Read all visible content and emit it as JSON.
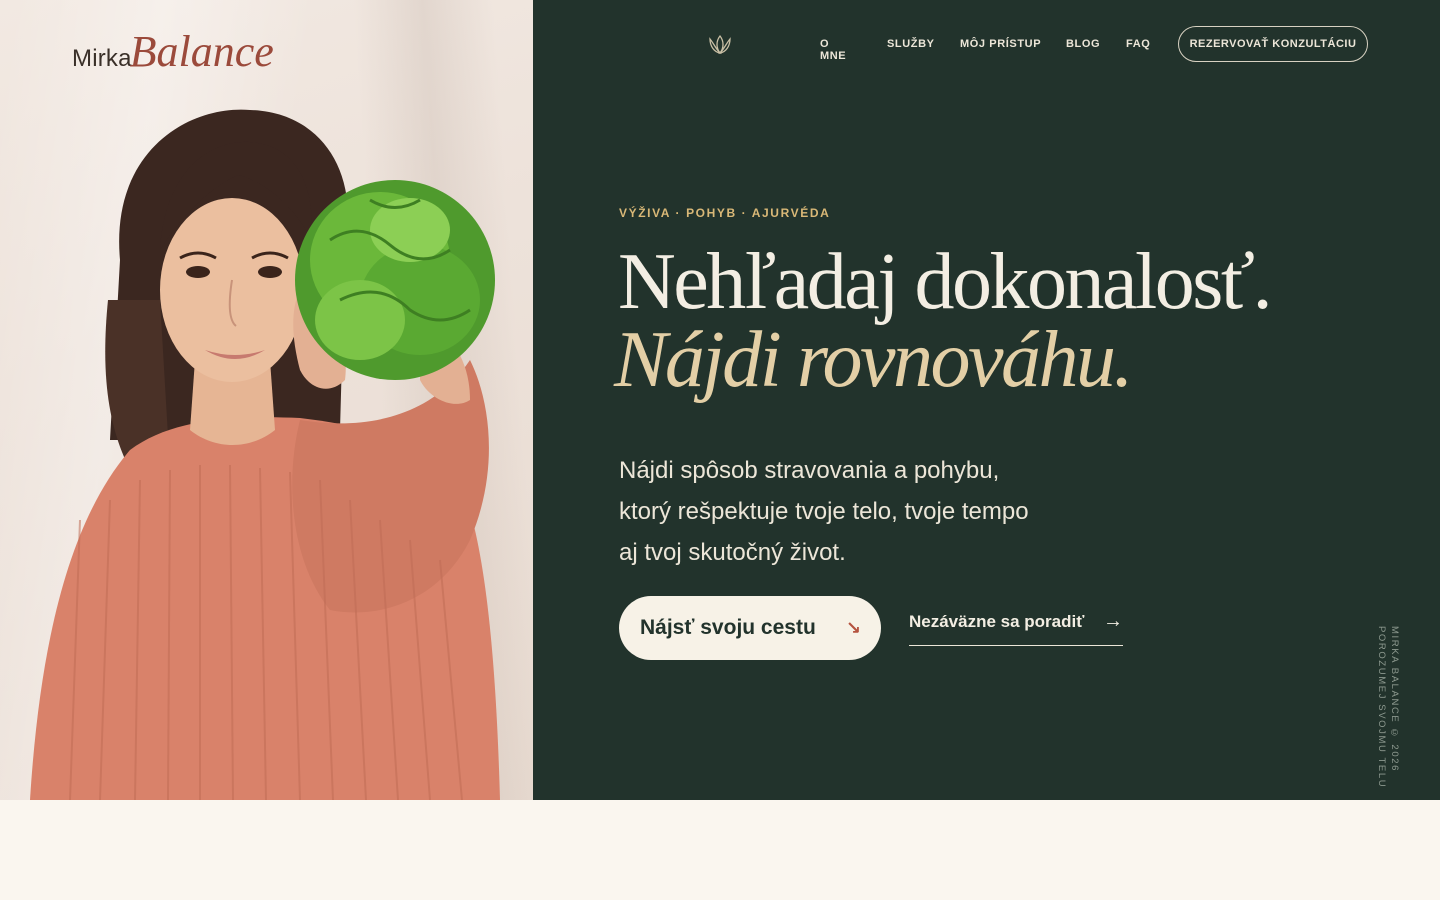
{
  "brand": {
    "logo_first": "Mirka",
    "logo_second": "Balance"
  },
  "nav": {
    "items": [
      "O MNE",
      "SLUŽBY",
      "MÔJ PRÍSTUP",
      "BLOG",
      "FAQ"
    ],
    "cta": "REZERVOVAŤ KONZULTÁCIU",
    "icon": "lotus-icon"
  },
  "hero": {
    "eyebrow": "VÝŽIVA · POHYB · AJURVÉDA",
    "headline_line1": "Nehľadaj dokonalosť.",
    "headline_line2": "Nájdi rovnováhu.",
    "lead": "Nájdi spôsob stravovania a pohybu, ktorý rešpektuje tvoje telo, tvoje tempo aj tvoj skutočný život.",
    "primary_button": "Nájsť svoju cestu",
    "primary_arrow": "↘",
    "secondary_link": "Nezáväzne sa poradiť",
    "secondary_arrow": "→",
    "vertical_line1": "MIRKA BALANCE © 2026",
    "vertical_line2": "POROZUMEJ SVOJMU TELU"
  },
  "colors": {
    "panel": "#22332c",
    "accent_gold": "#d9b877",
    "headline_italic": "#e3cfa6",
    "logo_accent": "#9b4a3b",
    "background": "#faf6ef"
  }
}
